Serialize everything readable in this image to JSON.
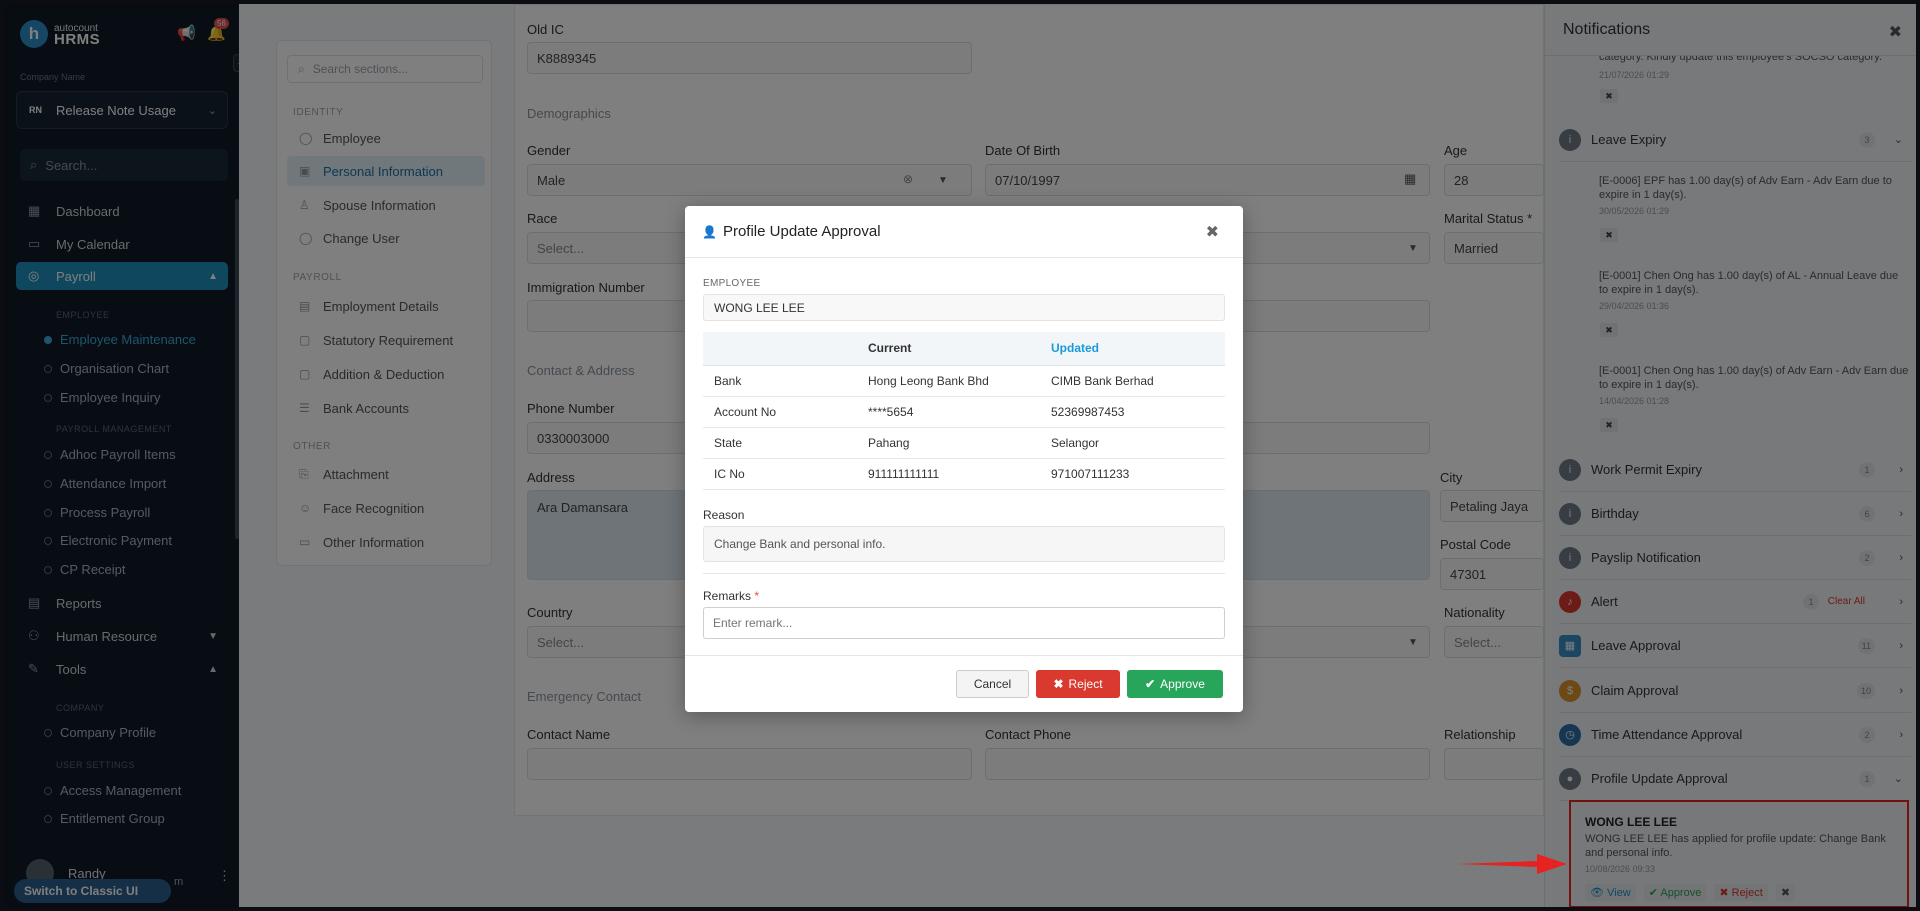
{
  "app": {
    "logo_top": "autocount",
    "logo_bottom": "HRMS",
    "notif_count": "56"
  },
  "sidebar": {
    "company_label": "Company Name",
    "company_initials": "RN",
    "company_name": "Release Note Usage",
    "search_placeholder": "Search...",
    "nav": {
      "dashboard": "Dashboard",
      "calendar": "My Calendar",
      "payroll": "Payroll",
      "reports": "Reports",
      "hr": "Human Resource",
      "tools": "Tools"
    },
    "sections": {
      "employee": "EMPLOYEE",
      "payroll_mgmt": "PAYROLL MANAGEMENT",
      "company": "COMPANY",
      "user_settings": "USER SETTINGS"
    },
    "subs": [
      "Employee Maintenance",
      "Organisation Chart",
      "Employee Inquiry",
      "Adhoc Payroll Items",
      "Attendance Import",
      "Process Payroll",
      "Electronic Payment",
      "CP Receipt",
      "Company Profile",
      "Access Management",
      "Entitlement Group"
    ],
    "user_name": "Randy",
    "user_email_tail": "m",
    "switch_label": "Switch to Classic UI"
  },
  "secnav": {
    "search_placeholder": "Search sections...",
    "labels": {
      "identity": "IDENTITY",
      "payroll": "PAYROLL",
      "other": "OTHER"
    },
    "items": [
      "Employee",
      "Personal Information",
      "Spouse Information",
      "Change User",
      "Employment Details",
      "Statutory Requirement",
      "Addition & Deduction",
      "Bank Accounts",
      "Attachment",
      "Face Recognition",
      "Other Information"
    ]
  },
  "form": {
    "old_ic_label": "Old IC",
    "old_ic": "K8889345",
    "demographics": "Demographics",
    "gender_label": "Gender",
    "gender": "Male",
    "dob_label": "Date Of Birth",
    "dob": "07/10/1997",
    "age_label": "Age",
    "age": "28",
    "race_label": "Race",
    "race": "Select...",
    "marital_label": "Marital Status *",
    "marital": "Married",
    "immigration_label": "Immigration Number",
    "contact_section": "Contact & Address",
    "phone_label": "Phone Number",
    "phone": "0330003000",
    "address_label": "Address",
    "address": "Ara Damansara",
    "city_label": "City",
    "city": "Petaling Jaya",
    "postal_label": "Postal Code",
    "postal": "47301",
    "country_label": "Country",
    "country": "Select...",
    "nationality_label": "Nationality",
    "nationality": "Select...",
    "emergency_section": "Emergency Contact",
    "contact_name_label": "Contact Name",
    "contact_phone_label": "Contact Phone",
    "relationship_label": "Relationship"
  },
  "modal": {
    "title": "Profile Update Approval",
    "employee_label": "EMPLOYEE",
    "employee": "WONG LEE LEE",
    "col_current": "Current",
    "col_updated": "Updated",
    "rows": [
      {
        "field": "Bank",
        "current": "Hong Leong Bank Bhd",
        "updated": "CIMB Bank Berhad"
      },
      {
        "field": "Account No",
        "current": "****5654",
        "updated": "52369987453"
      },
      {
        "field": "State",
        "current": "Pahang",
        "updated": "Selangor"
      },
      {
        "field": "IC No",
        "current": "911111111111",
        "updated": "971007111233"
      }
    ],
    "reason_label": "Reason",
    "reason": "Change Bank and personal info.",
    "remarks_label": "Remarks",
    "remarks_placeholder": "Enter remark...",
    "cancel": "Cancel",
    "reject": "Reject",
    "approve": "Approve"
  },
  "notifications": {
    "title": "Notifications",
    "top_partial_text": "category. Kindly update this employee's SOCSO category.",
    "top_partial_date": "21/07/2026 01:29",
    "groups": [
      {
        "title": "Leave Expiry",
        "count": "3"
      },
      {
        "title": "Work Permit Expiry",
        "count": "1"
      },
      {
        "title": "Birthday",
        "count": "6"
      },
      {
        "title": "Payslip Notification",
        "count": "2"
      },
      {
        "title": "Alert",
        "count": "1",
        "extra": "Clear All"
      },
      {
        "title": "Leave Approval",
        "count": "11"
      },
      {
        "title": "Claim Approval",
        "count": "10"
      },
      {
        "title": "Time Attendance Approval",
        "count": "2"
      },
      {
        "title": "Profile Update Approval",
        "count": "1"
      }
    ],
    "leave_items": [
      {
        "text": "[E-0006] EPF has 1.00 day(s) of Adv Earn - Adv Earn due to expire in 1 day(s).",
        "date": "30/05/2026 01:29"
      },
      {
        "text": "[E-0001] Chen Ong has 1.00 day(s) of AL - Annual Leave due to expire in 1 day(s).",
        "date": "29/04/2026 01:36"
      },
      {
        "text": "[E-0001] Chen Ong has 1.00 day(s) of Adv Earn - Adv Earn due to expire in 1 day(s).",
        "date": "14/04/2026 01:28"
      }
    ],
    "card": {
      "title": "WONG LEE LEE",
      "message": "WONG LEE LEE has applied for profile update: Change Bank and personal info.",
      "date": "10/08/2026 09:33",
      "view": "View",
      "approve": "Approve",
      "reject": "Reject"
    }
  },
  "colors": {
    "accent": "#1f8fbd",
    "reject": "#d9392e",
    "approve": "#27a55a",
    "highlight": "#e62222"
  }
}
